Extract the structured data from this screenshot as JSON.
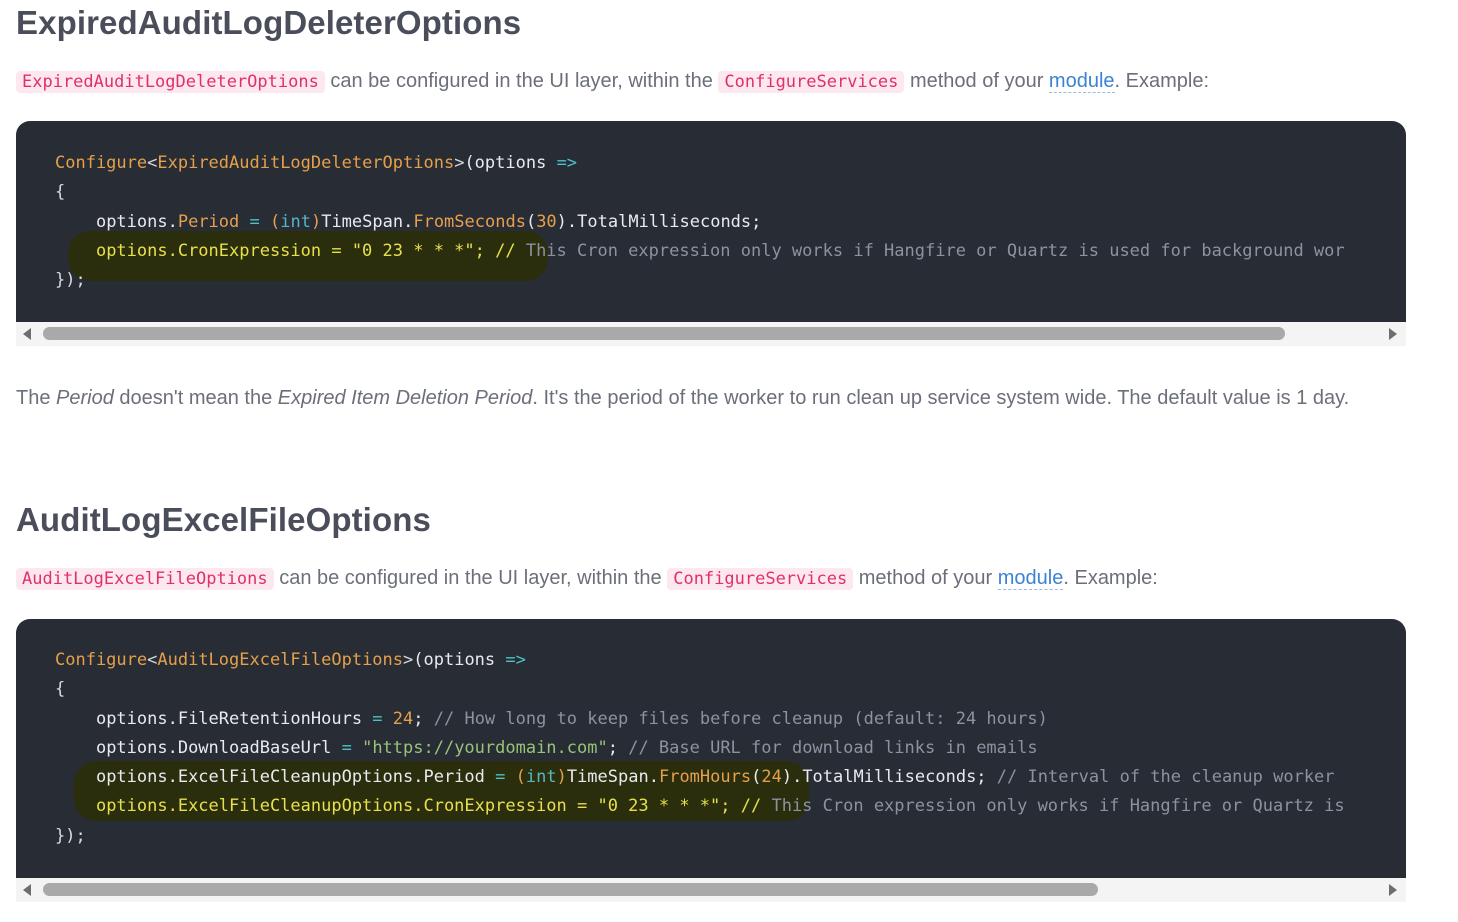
{
  "section1": {
    "heading": "ExpiredAuditLogDeleterOptions",
    "intro": {
      "code1": "ExpiredAuditLogDeleterOptions",
      "text1": " can be configured in the UI layer, within the ",
      "code2": "ConfigureServices",
      "text2": " method of your ",
      "link": "module",
      "text3": ". Example:"
    },
    "code_lines": {
      "l1_fn": "Configure",
      "l1_lt": "<",
      "l1_type": "ExpiredAuditLogDeleterOptions",
      "l1_gt": ">",
      "l1_rest": "(options ",
      "l1_arrow": "=>",
      "l2": "{",
      "l3_obj": "options.",
      "l3_prop": "Period",
      "l3_eq": " = ",
      "l3_paren": "(",
      "l3_kw": "int",
      "l3_paren2": ")",
      "l3_cls": "TimeSpan",
      "l3_dot": ".",
      "l3_method": "FromSeconds",
      "l3_p1": "(",
      "l3_num": "30",
      "l3_p2": ").",
      "l3_end": "TotalMilliseconds;",
      "l4_code": "options.CronExpression = \"0 23 * * *\"; // ",
      "l4_comment": "This Cron expression only works if Hangfire or Quartz is used for background wor",
      "l5": "});"
    },
    "scroll_thumb_fraction": 0.93
  },
  "note": {
    "t1": "The ",
    "em1": "Period",
    "t2": " doesn't mean the ",
    "em2": "Expired Item Deletion Period",
    "t3": ". It's the period of the worker to run clean up service system wide. The default value is 1 day."
  },
  "section2": {
    "heading": "AuditLogExcelFileOptions",
    "intro": {
      "code1": "AuditLogExcelFileOptions",
      "text1": " can be configured in the UI layer, within the ",
      "code2": "ConfigureServices",
      "text2": " method of your ",
      "link": "module",
      "text3": ". Example:"
    },
    "code_lines": {
      "l1_fn": "Configure",
      "l1_lt": "<",
      "l1_type": "AuditLogExcelFileOptions",
      "l1_gt": ">",
      "l1_rest": "(options ",
      "l1_arrow": "=>",
      "l2": "{",
      "l3_prop": "options.FileRetentionHours",
      "l3_eq": " = ",
      "l3_num": "24",
      "l3_semi": "; ",
      "l3_comment": "// How long to keep files before cleanup (default: 24 hours)",
      "l4_prop": "options.DownloadBaseUrl",
      "l4_eq": " = ",
      "l4_str": "\"https://yourdomain.com\"",
      "l4_semi": "; ",
      "l4_comment": "// Base URL for download links in emails",
      "l5_prop": "options.ExcelFileCleanupOptions.Period",
      "l5_eq": " = ",
      "l5_p": "(",
      "l5_kw": "int",
      "l5_p2": ")",
      "l5_cls": "TimeSpan",
      "l5_dot": ".",
      "l5_method": "FromHours",
      "l5_p3": "(",
      "l5_num": "24",
      "l5_p4": ").",
      "l5_end": "TotalMilliseconds; ",
      "l5_comment": "// Interval of the cleanup worker",
      "l6_code": "options.ExcelFileCleanupOptions.CronExpression = \"0 23 * * *\"; // ",
      "l6_comment": "This Cron expression only works if Hangfire or Quartz is",
      "l7": "});"
    },
    "scroll_thumb_fraction": 0.79
  },
  "colors": {
    "code_bg": "#282c34",
    "inline_code": "#e0306a",
    "link": "#3b82d6",
    "highlight": "#2b2e0c"
  }
}
